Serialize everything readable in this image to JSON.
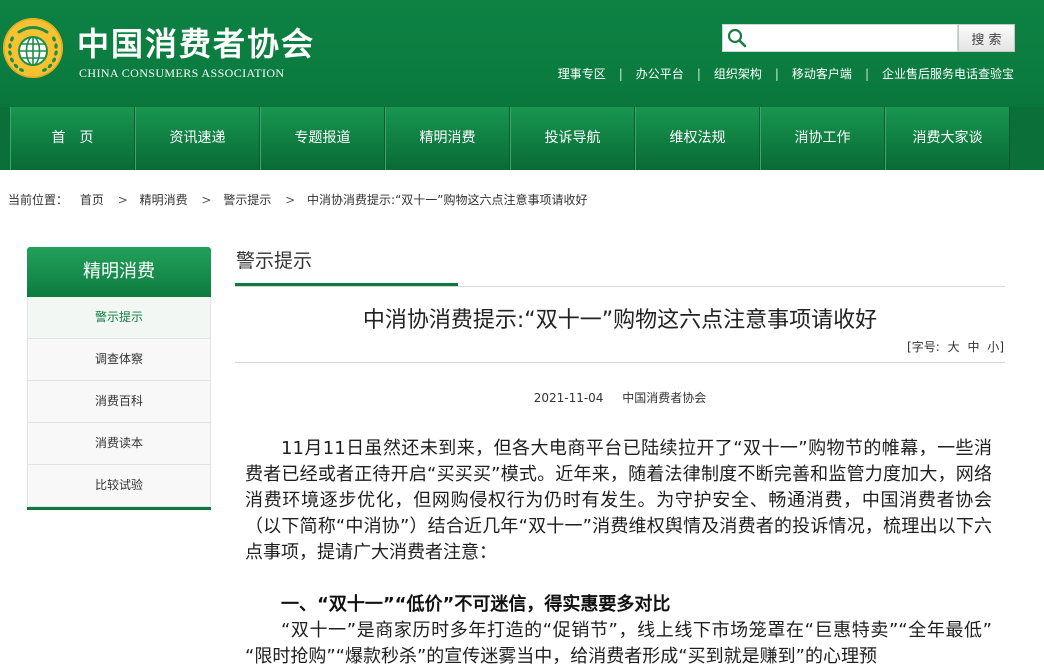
{
  "theme": {
    "accent": "#0c7a3c",
    "header_bg": "#0d8243",
    "nav_bg": "#0b6f39"
  },
  "header": {
    "logo_cn": "中国消费者协会",
    "logo_en": "CHINA CONSUMERS ASSOCIATION",
    "search": {
      "placeholder": "",
      "value": "",
      "button_label": "搜 索"
    },
    "top_links": [
      "理事专区",
      "办公平台",
      "组织架构",
      "移动客户端",
      "企业售后服务电话查验宝"
    ],
    "link_separator": "|"
  },
  "nav": {
    "items": [
      "首　页",
      "资讯速递",
      "专题报道",
      "精明消费",
      "投诉导航",
      "维权法规",
      "消协工作",
      "消费大家谈"
    ]
  },
  "breadcrumb": {
    "label": "当前位置：",
    "separator": ">",
    "items": [
      "首页",
      "精明消费",
      "警示提示",
      "中消协消费提示:“双十一”购物这六点注意事项请收好"
    ]
  },
  "sidebar": {
    "title": "精明消费",
    "items": [
      {
        "label": "警示提示",
        "active": true
      },
      {
        "label": "调查体察",
        "active": false
      },
      {
        "label": "消费百科",
        "active": false
      },
      {
        "label": "消费读本",
        "active": false
      },
      {
        "label": "比较试验",
        "active": false
      }
    ]
  },
  "main": {
    "section_title": "警示提示",
    "article": {
      "title": "中消协消费提示:“双十一”购物这六点注意事项请收好",
      "font_size_label": "[字号:",
      "font_sizes": [
        "大",
        "中",
        "小"
      ],
      "font_size_close": "]",
      "date": "2021-11-04",
      "source": "中国消费者协会",
      "intro": "11月11日虽然还未到来，但各大电商平台已陆续拉开了“双十一”购物节的帷幕，一些消费者已经或者正待开启“买买买”模式。近年来，随着法律制度不断完善和监管力度加大，网络消费环境逐步优化，但网购侵权行为仍时有发生。为守护安全、畅通消费，中国消费者协会（以下简称“中消协”）结合近几年“双十一”消费维权舆情及消费者的投诉情况，梳理出以下六点事项，提请广大消费者注意：",
      "heading1": "一、“双十一”“低价”不可迷信，得实惠要多对比",
      "para1": "“双十一”是商家历时多年打造的“促销节”，线上线下市场笼罩在“巨惠特卖”“全年最低”“限时抢购”“爆款秒杀”的宣传迷雾当中，给消费者形成“买到就是赚到”的心理预"
    }
  }
}
